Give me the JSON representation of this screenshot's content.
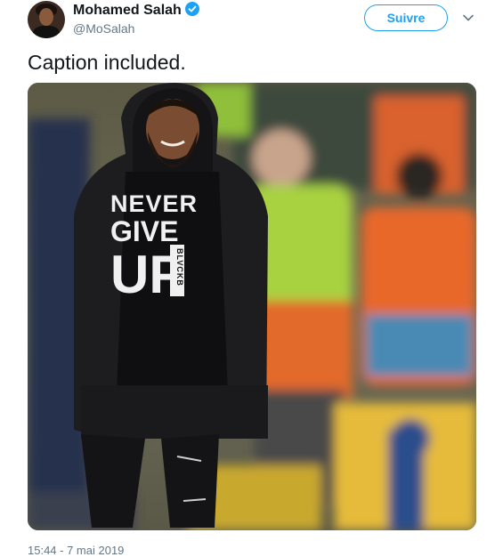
{
  "user": {
    "name": "Mohamed Salah",
    "handle": "@MoSalah"
  },
  "follow_label": "Suivre",
  "tweet": {
    "text": "Caption included.",
    "timestamp": "15:44 - 7 mai 2019"
  },
  "media": {
    "shirt_lines": [
      "NEVER",
      "GIVE",
      "UP"
    ],
    "shirt_tag": "BLVCKB"
  },
  "colors": {
    "accent": "#1da1f2",
    "text": "#14171a",
    "muted": "#657786"
  },
  "icons": {
    "verified": "verified-badge-icon",
    "dropdown": "chevron-down-icon"
  }
}
